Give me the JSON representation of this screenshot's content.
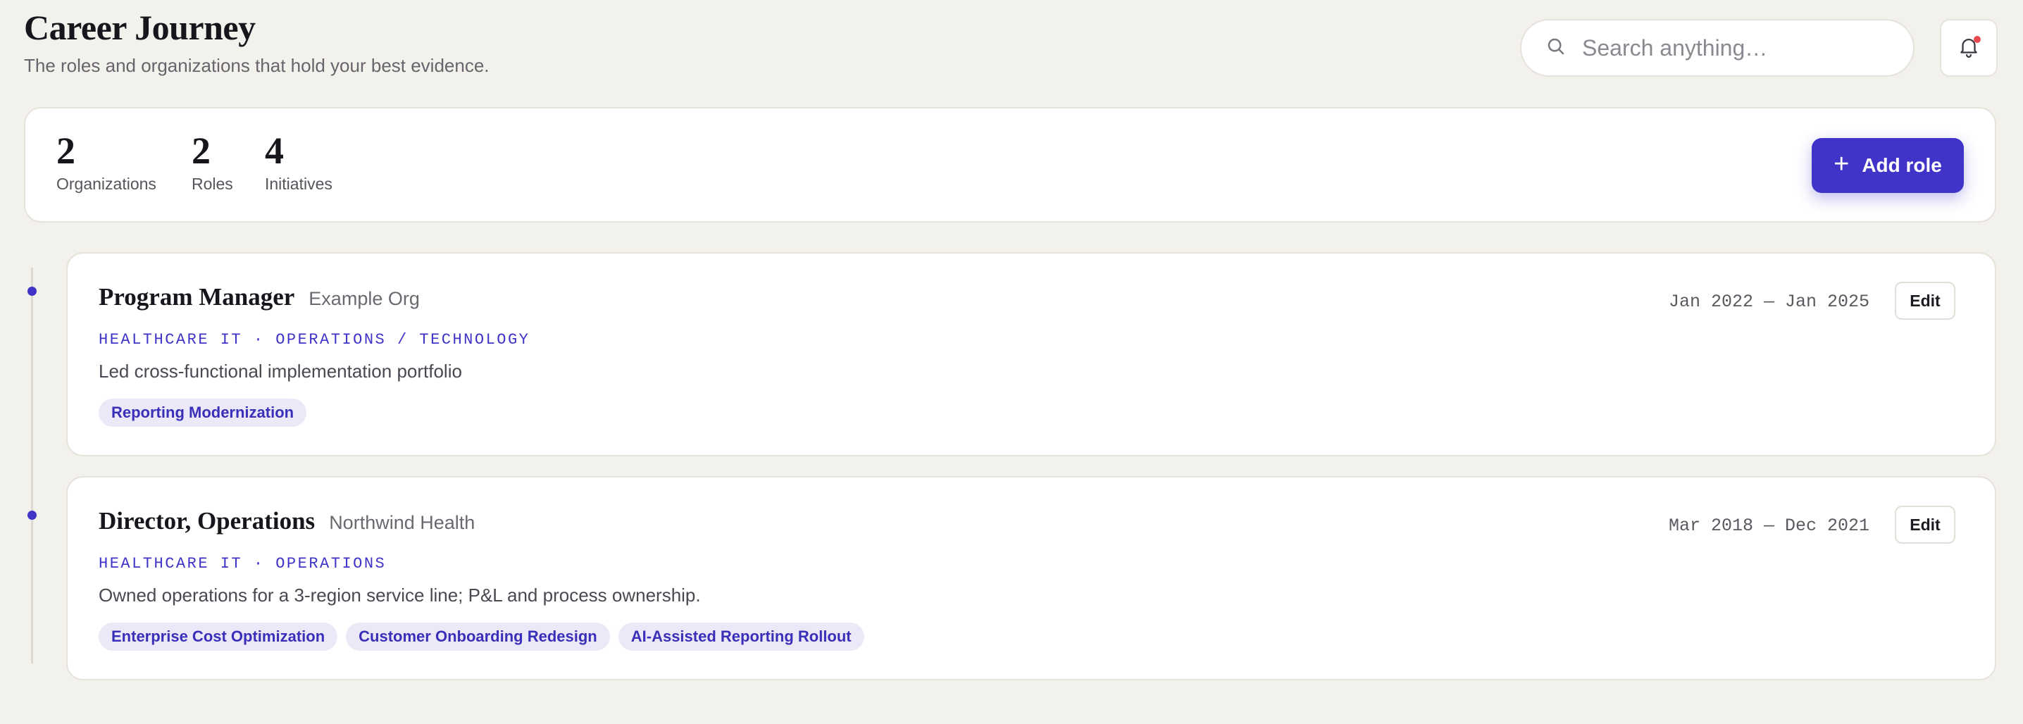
{
  "header": {
    "title": "Career Journey",
    "subtitle": "The roles and organizations that hold your best evidence."
  },
  "search": {
    "placeholder": "Search anything…",
    "icon": "search-icon"
  },
  "notifications": {
    "icon": "bell-icon",
    "has_unread": true,
    "dot_color": "#e5484d"
  },
  "stats": [
    {
      "value": "2",
      "label": "Organizations"
    },
    {
      "value": "2",
      "label": "Roles"
    },
    {
      "value": "4",
      "label": "Initiatives"
    }
  ],
  "actions": {
    "add_role_label": "Add role",
    "add_role_icon": "plus-icon"
  },
  "colors": {
    "accent": "#3f33c8",
    "background": "#f3f1ec",
    "chip_bg": "#ebe9f8"
  },
  "roles": [
    {
      "title": "Program Manager",
      "org": "Example Org",
      "dates": "Jan 2022 — Jan 2025",
      "edit_label": "Edit",
      "tags": "HEALTHCARE IT · OPERATIONS / TECHNOLOGY",
      "description": "Led cross-functional implementation portfolio",
      "initiatives": [
        "Reporting Modernization"
      ]
    },
    {
      "title": "Director, Operations",
      "org": "Northwind Health",
      "dates": "Mar 2018 — Dec 2021",
      "edit_label": "Edit",
      "tags": "HEALTHCARE IT · OPERATIONS",
      "description": "Owned operations for a 3-region service line; P&L and process ownership.",
      "initiatives": [
        "Enterprise Cost Optimization",
        "Customer Onboarding Redesign",
        "AI-Assisted Reporting Rollout"
      ]
    }
  ]
}
